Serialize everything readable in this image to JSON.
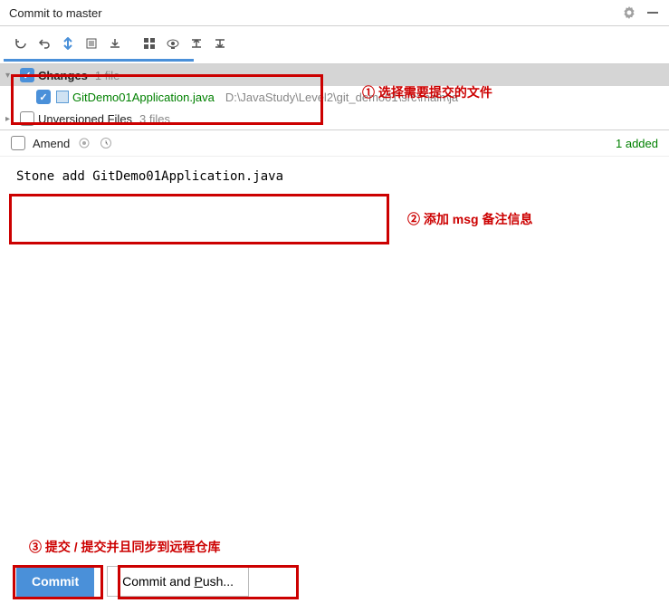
{
  "header": {
    "title": "Commit to master"
  },
  "tree": {
    "changes": {
      "label": "Changes",
      "count": "1 file"
    },
    "file": {
      "name": "GitDemo01Application.java",
      "path": "D:\\JavaStudy\\Level2\\git_demo01\\src\\main\\ja"
    },
    "unversioned": {
      "label": "Unversioned Files",
      "count": "3 files"
    }
  },
  "amend": {
    "label": "Amend",
    "status": "1 added"
  },
  "commit": {
    "message": "Stone add GitDemo01Application.java"
  },
  "buttons": {
    "commit": "Commit",
    "commitPush": "Commit and Push..."
  },
  "annotations": {
    "a1": "① 选择需要提交的文件",
    "a2": "② 添加 msg 备注信息",
    "a3": "③ 提交 / 提交并且同步到远程仓库"
  }
}
